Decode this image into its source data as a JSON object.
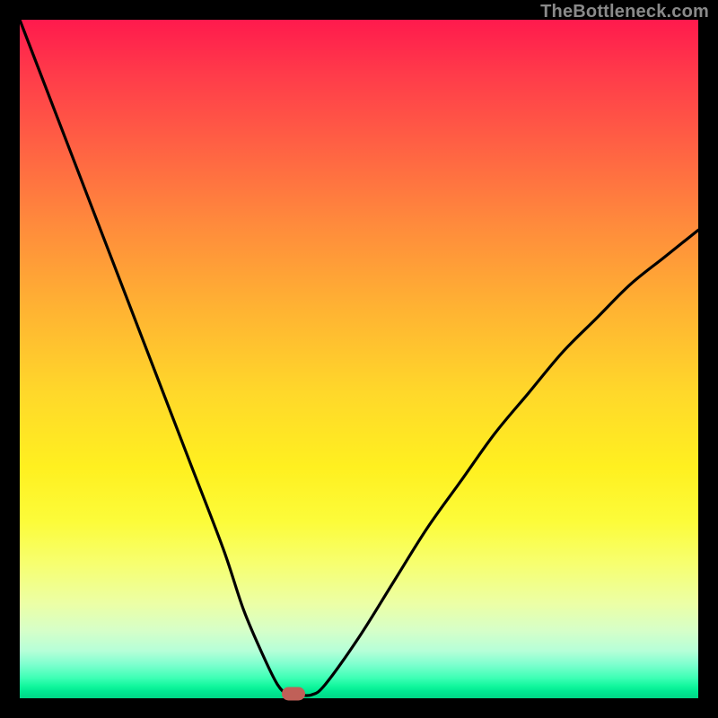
{
  "watermark": "TheBottleneck.com",
  "colors": {
    "frame": "#000000",
    "curve_stroke": "#000000",
    "marker": "#c06058"
  },
  "chart_data": {
    "type": "line",
    "title": "",
    "xlabel": "",
    "ylabel": "",
    "xlim": [
      0,
      100
    ],
    "ylim": [
      0,
      100
    ],
    "series": [
      {
        "name": "bottleneck-curve",
        "x": [
          0,
          5,
          10,
          15,
          20,
          25,
          30,
          33,
          36,
          38,
          39.5,
          41,
          43,
          45,
          50,
          55,
          60,
          65,
          70,
          75,
          80,
          85,
          90,
          95,
          100
        ],
        "y": [
          100,
          87,
          74,
          61,
          48,
          35,
          22,
          13,
          6,
          2,
          0.5,
          0.5,
          0.5,
          2,
          9,
          17,
          25,
          32,
          39,
          45,
          51,
          56,
          61,
          65,
          69
        ]
      }
    ],
    "marker": {
      "x": 40.3,
      "y": 0.7
    },
    "gradient_meaning": "red=high bottleneck, green=low bottleneck"
  }
}
